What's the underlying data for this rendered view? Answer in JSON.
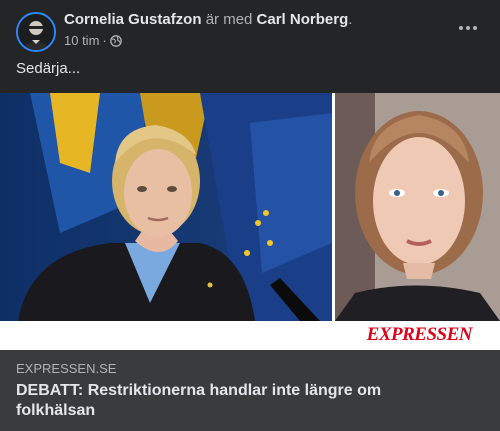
{
  "post": {
    "author": "Cornelia Gustafzon",
    "with_text": "är med",
    "tagged": "Carl Norberg",
    "period": ".",
    "time": "10 tim",
    "dot": "·",
    "audience_icon": "globe-icon",
    "more_icon": "more-horizontal-icon",
    "text": "Sedärja..."
  },
  "link": {
    "brand": "EXPRESSEN",
    "domain": "EXPRESSEN.SE",
    "headline": "DEBATT: Restriktionerna handlar inte längre om folkhälsan"
  },
  "colors": {
    "background": "#242526",
    "card": "#3a3b3c",
    "text": "#e4e6eb",
    "muted": "#b0b3b8",
    "brand_red": "#e0001b"
  }
}
